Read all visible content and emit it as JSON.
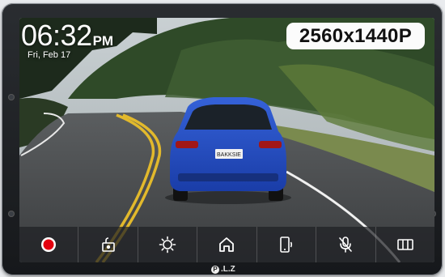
{
  "status": {
    "time": "06:32",
    "ampm": "PM",
    "date": "Fri, Feb 17",
    "resolution": "2560x1440P"
  },
  "scene": {
    "plate": "BAKKSIE"
  },
  "toolbar": {
    "buttons": [
      {
        "name": "record-button",
        "icon": "record-icon"
      },
      {
        "name": "lock-file-button",
        "icon": "lock-icon"
      },
      {
        "name": "settings-button",
        "icon": "gear-icon"
      },
      {
        "name": "home-button",
        "icon": "home-icon"
      },
      {
        "name": "phone-button",
        "icon": "phone-icon"
      },
      {
        "name": "microphone-button",
        "icon": "microphone-muted-icon"
      },
      {
        "name": "split-view-button",
        "icon": "split-view-icon"
      }
    ]
  },
  "brand": {
    "logo_mark": "P",
    "logo_text": ".L.Z"
  },
  "colors": {
    "record": "#e3000f",
    "badge_bg": "#fbfbfb",
    "car": "#1f4fc9"
  }
}
